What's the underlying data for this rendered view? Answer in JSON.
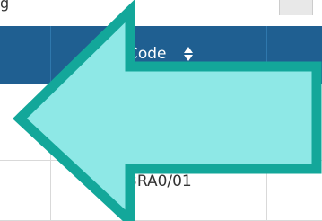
{
  "topbar": {
    "partial_text": "g"
  },
  "table": {
    "columns": [
      {
        "label": ""
      },
      {
        "label": "Code",
        "sort_icon": "sort-icon"
      },
      {
        "label": ""
      }
    ],
    "rows": [
      {
        "code": ""
      },
      {
        "code": "3RA0/01"
      }
    ]
  },
  "overlay": {
    "icon": "left-arrow-icon",
    "fill": "#8ee8e6",
    "stroke": "#13a79a"
  }
}
